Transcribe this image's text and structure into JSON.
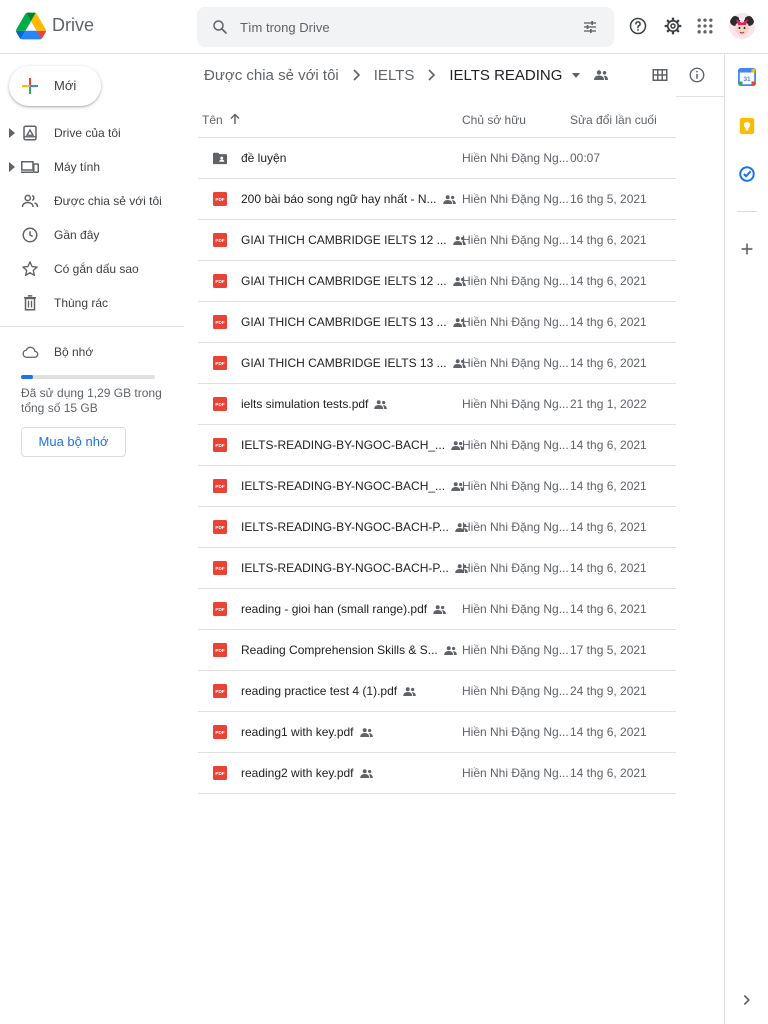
{
  "app": {
    "name": "Drive"
  },
  "search": {
    "placeholder": "Tìm trong Drive"
  },
  "header_icons": [
    "help-icon",
    "settings-icon",
    "apps-grid-icon"
  ],
  "sidebar": {
    "new_label": "Mới",
    "items": [
      {
        "label": "Drive của tôi",
        "icon": "my-drive-icon",
        "expandable": true
      },
      {
        "label": "Máy tính",
        "icon": "computer-icon",
        "expandable": true
      },
      {
        "label": "Được chia sẻ với tôi",
        "icon": "shared-with-me-icon",
        "expandable": false
      },
      {
        "label": "Gần đây",
        "icon": "clock-icon",
        "expandable": false
      },
      {
        "label": "Có gắn dấu sao",
        "icon": "star-icon",
        "expandable": false
      },
      {
        "label": "Thùng rác",
        "icon": "trash-icon",
        "expandable": false
      }
    ],
    "storage": {
      "label": "Bộ nhớ",
      "usage_text": "Đã sử dụng 1,29 GB trong tổng số 15 GB",
      "used_fraction": 0.086,
      "buy_label": "Mua bộ nhớ"
    }
  },
  "breadcrumb": {
    "items": [
      "Được chia sẻ với tôi",
      "IELTS"
    ],
    "current": "IELTS READING"
  },
  "table": {
    "headers": {
      "name": "Tên",
      "owner": "Chủ sở hữu",
      "modified": "Sửa đổi lần cuối"
    },
    "rows": [
      {
        "type": "folder",
        "name": "đề luyện",
        "shared": false,
        "owner": "Hiền Nhi Đặng Ng...",
        "modified": "00:07"
      },
      {
        "type": "pdf",
        "name": "200 bài báo song ngữ hay nhất - N...",
        "shared": true,
        "owner": "Hiền Nhi Đặng Ng...",
        "modified": "16 thg 5, 2021"
      },
      {
        "type": "pdf",
        "name": "GIAI THICH CAMBRIDGE IELTS 12 ...",
        "shared": true,
        "owner": "Hiền Nhi Đặng Ng...",
        "modified": "14 thg 6, 2021"
      },
      {
        "type": "pdf",
        "name": "GIAI THICH CAMBRIDGE IELTS 12 ...",
        "shared": true,
        "owner": "Hiền Nhi Đặng Ng...",
        "modified": "14 thg 6, 2021"
      },
      {
        "type": "pdf",
        "name": "GIAI THICH CAMBRIDGE IELTS 13 ...",
        "shared": true,
        "owner": "Hiền Nhi Đặng Ng...",
        "modified": "14 thg 6, 2021"
      },
      {
        "type": "pdf",
        "name": "GIAI THICH CAMBRIDGE IELTS 13 ...",
        "shared": true,
        "owner": "Hiền Nhi Đặng Ng...",
        "modified": "14 thg 6, 2021"
      },
      {
        "type": "pdf",
        "name": "ielts simulation tests.pdf",
        "shared": true,
        "owner": "Hiền Nhi Đặng Ng...",
        "modified": "21 thg 1, 2022"
      },
      {
        "type": "pdf",
        "name": "IELTS-READING-BY-NGOC-BACH_...",
        "shared": true,
        "owner": "Hiền Nhi Đặng Ng...",
        "modified": "14 thg 6, 2021"
      },
      {
        "type": "pdf",
        "name": "IELTS-READING-BY-NGOC-BACH_...",
        "shared": true,
        "owner": "Hiền Nhi Đặng Ng...",
        "modified": "14 thg 6, 2021"
      },
      {
        "type": "pdf",
        "name": "IELTS-READING-BY-NGOC-BACH-P...",
        "shared": true,
        "owner": "Hiền Nhi Đặng Ng...",
        "modified": "14 thg 6, 2021"
      },
      {
        "type": "pdf",
        "name": "IELTS-READING-BY-NGOC-BACH-P...",
        "shared": true,
        "owner": "Hiền Nhi Đặng Ng...",
        "modified": "14 thg 6, 2021"
      },
      {
        "type": "pdf",
        "name": "reading - gioi han (small range).pdf",
        "shared": true,
        "owner": "Hiền Nhi Đặng Ng...",
        "modified": "14 thg 6, 2021"
      },
      {
        "type": "pdf",
        "name": "Reading Comprehension Skills & S...",
        "shared": true,
        "owner": "Hiền Nhi Đặng Ng...",
        "modified": "17 thg 5, 2021"
      },
      {
        "type": "pdf",
        "name": "reading practice test 4 (1).pdf",
        "shared": true,
        "owner": "Hiền Nhi Đặng Ng...",
        "modified": "24 thg 9, 2021"
      },
      {
        "type": "pdf",
        "name": "reading1 with key.pdf",
        "shared": true,
        "owner": "Hiền Nhi Đặng Ng...",
        "modified": "14 thg 6, 2021"
      },
      {
        "type": "pdf",
        "name": "reading2 with key.pdf",
        "shared": true,
        "owner": "Hiền Nhi Đặng Ng...",
        "modified": "14 thg 6, 2021"
      }
    ]
  },
  "pdf_icon_text": "PDF",
  "calendar_icon_text": "31",
  "colors": {
    "accent": "#1a73e8",
    "pdf_red": "#ea4335",
    "text_secondary": "#5f6368",
    "divider": "#e0e0e0"
  }
}
